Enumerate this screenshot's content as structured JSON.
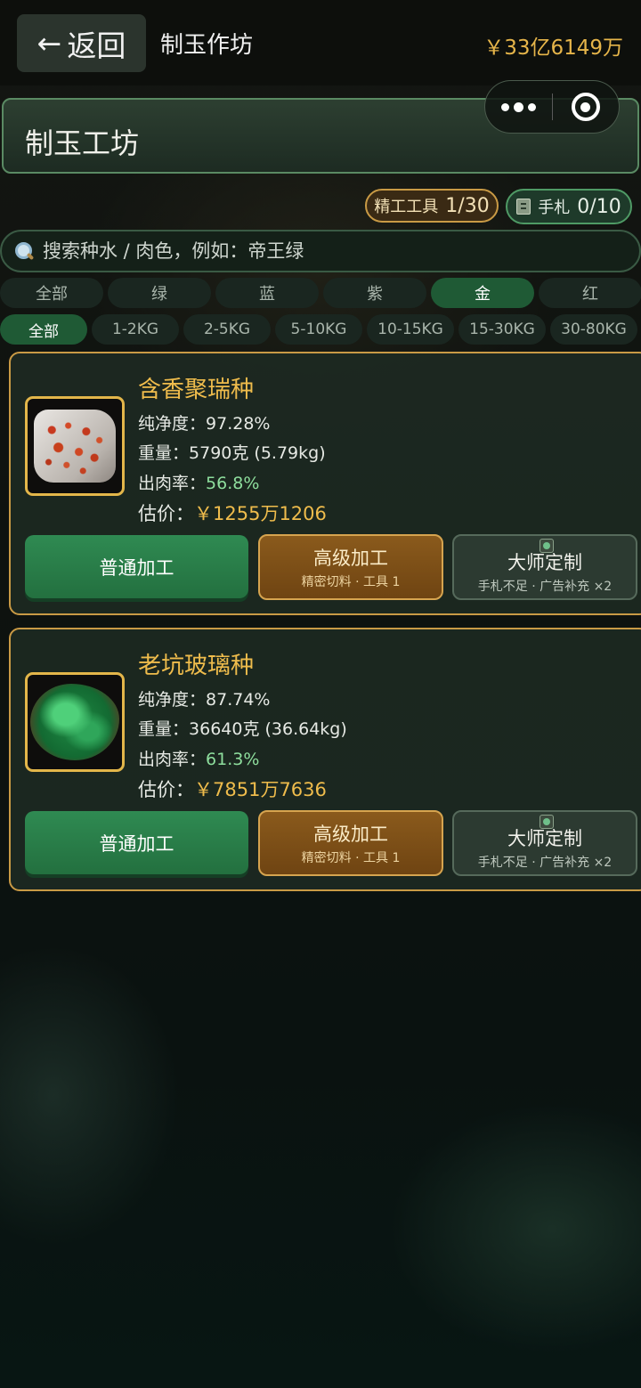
{
  "topbar": {
    "back_label": "返回",
    "title": "制玉作坊",
    "balance": "￥33亿6149万"
  },
  "banner": {
    "title": "制玉工坊"
  },
  "counters": {
    "tools_label": "精工工具",
    "tools_value": "1/30",
    "notes_label": "手札",
    "notes_value": "0/10"
  },
  "search": {
    "placeholder": "搜索种水 / 肉色，例如：帝王绿",
    "value": ""
  },
  "color_tabs": [
    {
      "label": "全部"
    },
    {
      "label": "绿"
    },
    {
      "label": "蓝"
    },
    {
      "label": "紫"
    },
    {
      "label": "金",
      "active": true
    },
    {
      "label": "红"
    }
  ],
  "weight_chips": [
    {
      "label": "全部",
      "active": true
    },
    {
      "label": "1-2KG"
    },
    {
      "label": "2-5KG"
    },
    {
      "label": "5-10KG"
    },
    {
      "label": "10-15KG"
    },
    {
      "label": "15-30KG"
    },
    {
      "label": "30-80KG"
    }
  ],
  "items": [
    {
      "name": "含香聚瑞种",
      "purity_label": "纯净度：",
      "purity": "97.28%",
      "weight_label": "重量：",
      "weight": "5790克 (5.79kg)",
      "yield_label": "出肉率：",
      "yield": "56.8%",
      "price_label": "估价：",
      "price": "￥1255万1206",
      "image_icon": "red-speckled-stone",
      "btn_normal": "普通加工",
      "btn_adv": "高级加工",
      "btn_adv_sub": "精密切料 · 工具 1",
      "btn_master": "大师定制",
      "btn_master_sub": "手札不足 · 广告补充 ×2"
    },
    {
      "name": "老坑玻璃种",
      "purity_label": "纯净度：",
      "purity": "87.74%",
      "weight_label": "重量：",
      "weight": "36640克 (36.64kg)",
      "yield_label": "出肉率：",
      "yield": "61.3%",
      "price_label": "估价：",
      "price": "￥7851万7636",
      "image_icon": "green-jade-stone",
      "btn_normal": "普通加工",
      "btn_adv": "高级加工",
      "btn_adv_sub": "精密切料 · 工具 1",
      "btn_master": "大师定制",
      "btn_master_sub": "手札不足 · 广告补充 ×2"
    }
  ],
  "colors": {
    "accent_gold": "#efbc4c",
    "accent_green": "#1f5a35",
    "yield_green": "#8ede9d",
    "advanced_brown": "#8a5a1c"
  }
}
